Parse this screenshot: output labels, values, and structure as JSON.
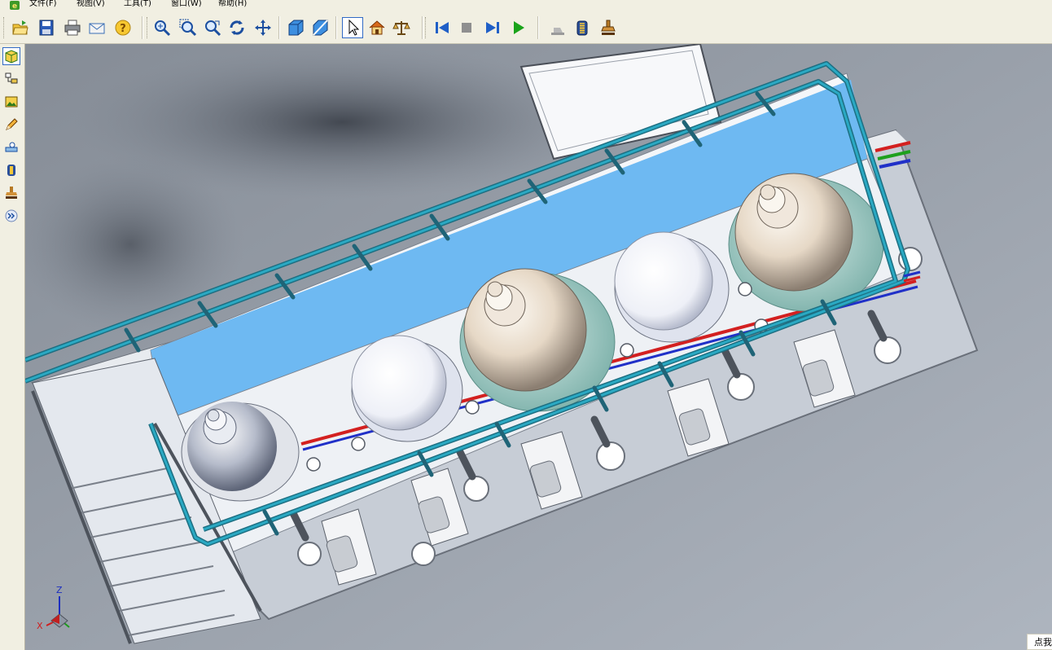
{
  "menu": {
    "items": [
      "文件(F)",
      "视图(V)",
      "工具(T)",
      "窗口(W)",
      "帮助(H)"
    ]
  },
  "toolbar": {
    "groups": [
      [
        "open-icon",
        "save-icon",
        "print-icon",
        "email-icon",
        "help-icon"
      ],
      [
        "zoom-icon",
        "zoom-area-icon",
        "zoom-fit-icon",
        "rotate-icon",
        "pan-icon"
      ],
      [
        "shaded-view-icon",
        "section-view-icon"
      ],
      [
        "select-icon",
        "home-view-icon",
        "measure-icon"
      ],
      [
        "go-to-start-icon",
        "stop-icon",
        "step-forward-icon",
        "play-icon"
      ],
      [
        "markup-icon",
        "material-icon",
        "stamp-icon"
      ]
    ],
    "active": "select-icon"
  },
  "sidebar": {
    "items": [
      "model-tree-icon",
      "assembly-tree-icon",
      "image-icon",
      "pencil-icon",
      "measure-tool-icon",
      "material-tool-icon",
      "stamp-tool-icon",
      "expand-icon"
    ],
    "active": "model-tree-icon"
  },
  "triad": {
    "x_label": "X",
    "y_label": "Y",
    "z_label": "Z"
  },
  "status": {
    "tooltip": "点我"
  },
  "colors": {
    "railing": "#2aa9c3",
    "platform": "#6eb9f2",
    "pipe_red": "#d32020",
    "pipe_green": "#1ea01e",
    "pipe_blue": "#2030c8",
    "toolbar_bg": "#f1efe2"
  }
}
